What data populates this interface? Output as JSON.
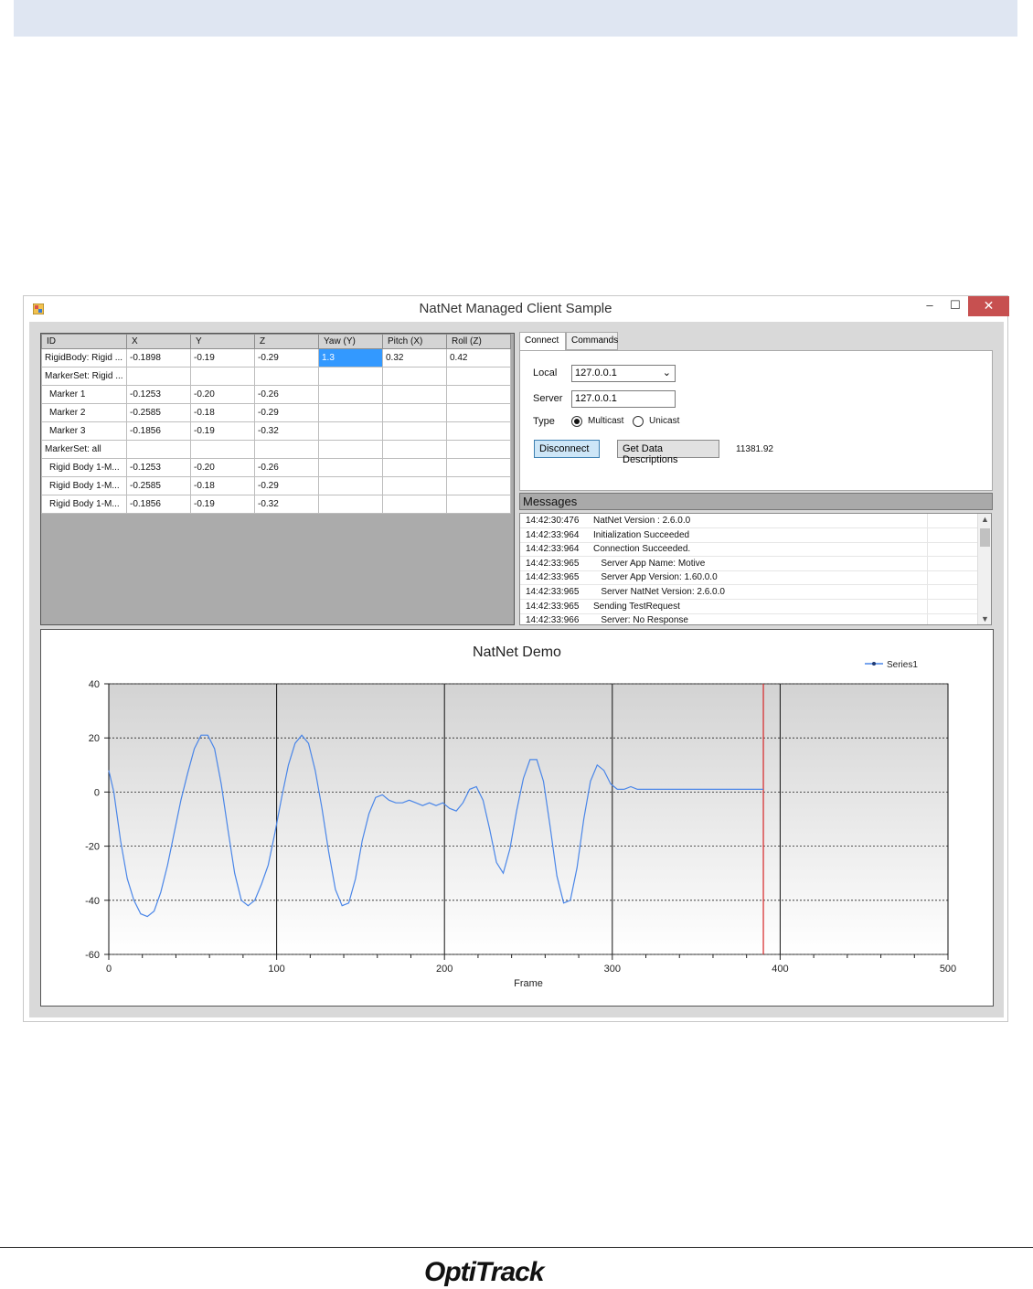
{
  "window": {
    "title": "NatNet Managed Client Sample",
    "minimize": "–",
    "maximize": "☐",
    "close": "✕"
  },
  "grid": {
    "columns": [
      "ID",
      "X",
      "Y",
      "Z",
      "Yaw (Y)",
      "Pitch (X)",
      "Roll (Z)"
    ],
    "rows": [
      [
        "RigidBody: Rigid ...",
        "-0.1898",
        "-0.19",
        "-0.29",
        "1.3",
        "0.32",
        "0.42"
      ],
      [
        "MarkerSet: Rigid ...",
        "",
        "",
        "",
        "",
        "",
        ""
      ],
      [
        " Marker 1",
        "-0.1253",
        "-0.20",
        "-0.26",
        "",
        "",
        ""
      ],
      [
        " Marker 2",
        "-0.2585",
        "-0.18",
        "-0.29",
        "",
        "",
        ""
      ],
      [
        " Marker 3",
        "-0.1856",
        "-0.19",
        "-0.32",
        "",
        "",
        ""
      ],
      [
        "MarkerSet: all",
        "",
        "",
        "",
        "",
        "",
        ""
      ],
      [
        " Rigid Body 1-M...",
        "-0.1253",
        "-0.20",
        "-0.26",
        "",
        "",
        ""
      ],
      [
        " Rigid Body 1-M...",
        "-0.2585",
        "-0.18",
        "-0.29",
        "",
        "",
        ""
      ],
      [
        " Rigid Body 1-M...",
        "-0.1856",
        "-0.19",
        "-0.32",
        "",
        "",
        ""
      ]
    ],
    "selected_cell": {
      "row": 0,
      "col": 4
    }
  },
  "connect": {
    "tabs": [
      "Connect",
      "Commands"
    ],
    "active_tab": 0,
    "local_label": "Local",
    "local_value": "127.0.0.1",
    "server_label": "Server",
    "server_value": "127.0.0.1",
    "type_label": "Type",
    "multicast_label": "Multicast",
    "unicast_label": "Unicast",
    "selected_type": "Multicast",
    "disconnect_label": "Disconnect",
    "get_desc_label": "Get Data Descriptions",
    "readout": "11381.92"
  },
  "messages": {
    "header": "Messages",
    "items": [
      {
        "time": "14:42:30:476",
        "text": "NatNet Version : 2.6.0.0"
      },
      {
        "time": "14:42:33:964",
        "text": "Initialization Succeeded"
      },
      {
        "time": "14:42:33:964",
        "text": "Connection Succeeded."
      },
      {
        "time": "14:42:33:965",
        "text": "   Server App Name: Motive"
      },
      {
        "time": "14:42:33:965",
        "text": "   Server App Version: 1.60.0.0"
      },
      {
        "time": "14:42:33:965",
        "text": "   Server NatNet Version: 2.6.0.0"
      },
      {
        "time": "14:42:33:965",
        "text": "Sending TestRequest"
      },
      {
        "time": "14:42:33:966",
        "text": "   Server: No Response"
      }
    ]
  },
  "chart_data": {
    "type": "line",
    "title": "NatNet Demo",
    "xlabel": "Frame",
    "ylabel": "",
    "xlim": [
      0,
      500
    ],
    "ylim": [
      -60,
      40
    ],
    "x_ticks": [
      0,
      100,
      200,
      300,
      400,
      500
    ],
    "y_ticks": [
      40,
      20,
      0,
      -20,
      -40,
      -60
    ],
    "legend_position": "top-right",
    "cursor_x": 390,
    "series": [
      {
        "name": "Series1",
        "color": "#4a86e8",
        "x": [
          0,
          3,
          7,
          11,
          15,
          19,
          23,
          27,
          31,
          35,
          39,
          43,
          47,
          51,
          55,
          59,
          63,
          67,
          71,
          75,
          79,
          83,
          87,
          91,
          95,
          99,
          103,
          107,
          111,
          115,
          119,
          123,
          127,
          131,
          135,
          139,
          143,
          147,
          151,
          155,
          159,
          163,
          167,
          171,
          175,
          179,
          183,
          187,
          191,
          195,
          199,
          203,
          207,
          211,
          215,
          219,
          223,
          227,
          231,
          235,
          239,
          243,
          247,
          251,
          255,
          259,
          263,
          267,
          271,
          275,
          279,
          283,
          287,
          291,
          295,
          299,
          303,
          307,
          311,
          315,
          320,
          330,
          340,
          350,
          360,
          370,
          380,
          390
        ],
        "y": [
          8,
          0,
          -18,
          -32,
          -40,
          -45,
          -46,
          -44,
          -37,
          -27,
          -15,
          -3,
          7,
          16,
          21,
          21,
          16,
          3,
          -14,
          -30,
          -40,
          -42,
          -40,
          -34,
          -27,
          -15,
          -2,
          10,
          18,
          21,
          18,
          8,
          -6,
          -22,
          -36,
          -42,
          -41,
          -32,
          -18,
          -8,
          -2,
          -1,
          -3,
          -4,
          -4,
          -3,
          -4,
          -5,
          -4,
          -5,
          -4,
          -6,
          -7,
          -4,
          1,
          2,
          -3,
          -14,
          -26,
          -30,
          -21,
          -7,
          5,
          12,
          12,
          4,
          -13,
          -31,
          -41,
          -40,
          -28,
          -10,
          4,
          10,
          8,
          3,
          1,
          1,
          2,
          1,
          1,
          1,
          1,
          1,
          1,
          1,
          1,
          1
        ]
      }
    ]
  },
  "footer": {
    "logo_text": "OptiTrack"
  }
}
